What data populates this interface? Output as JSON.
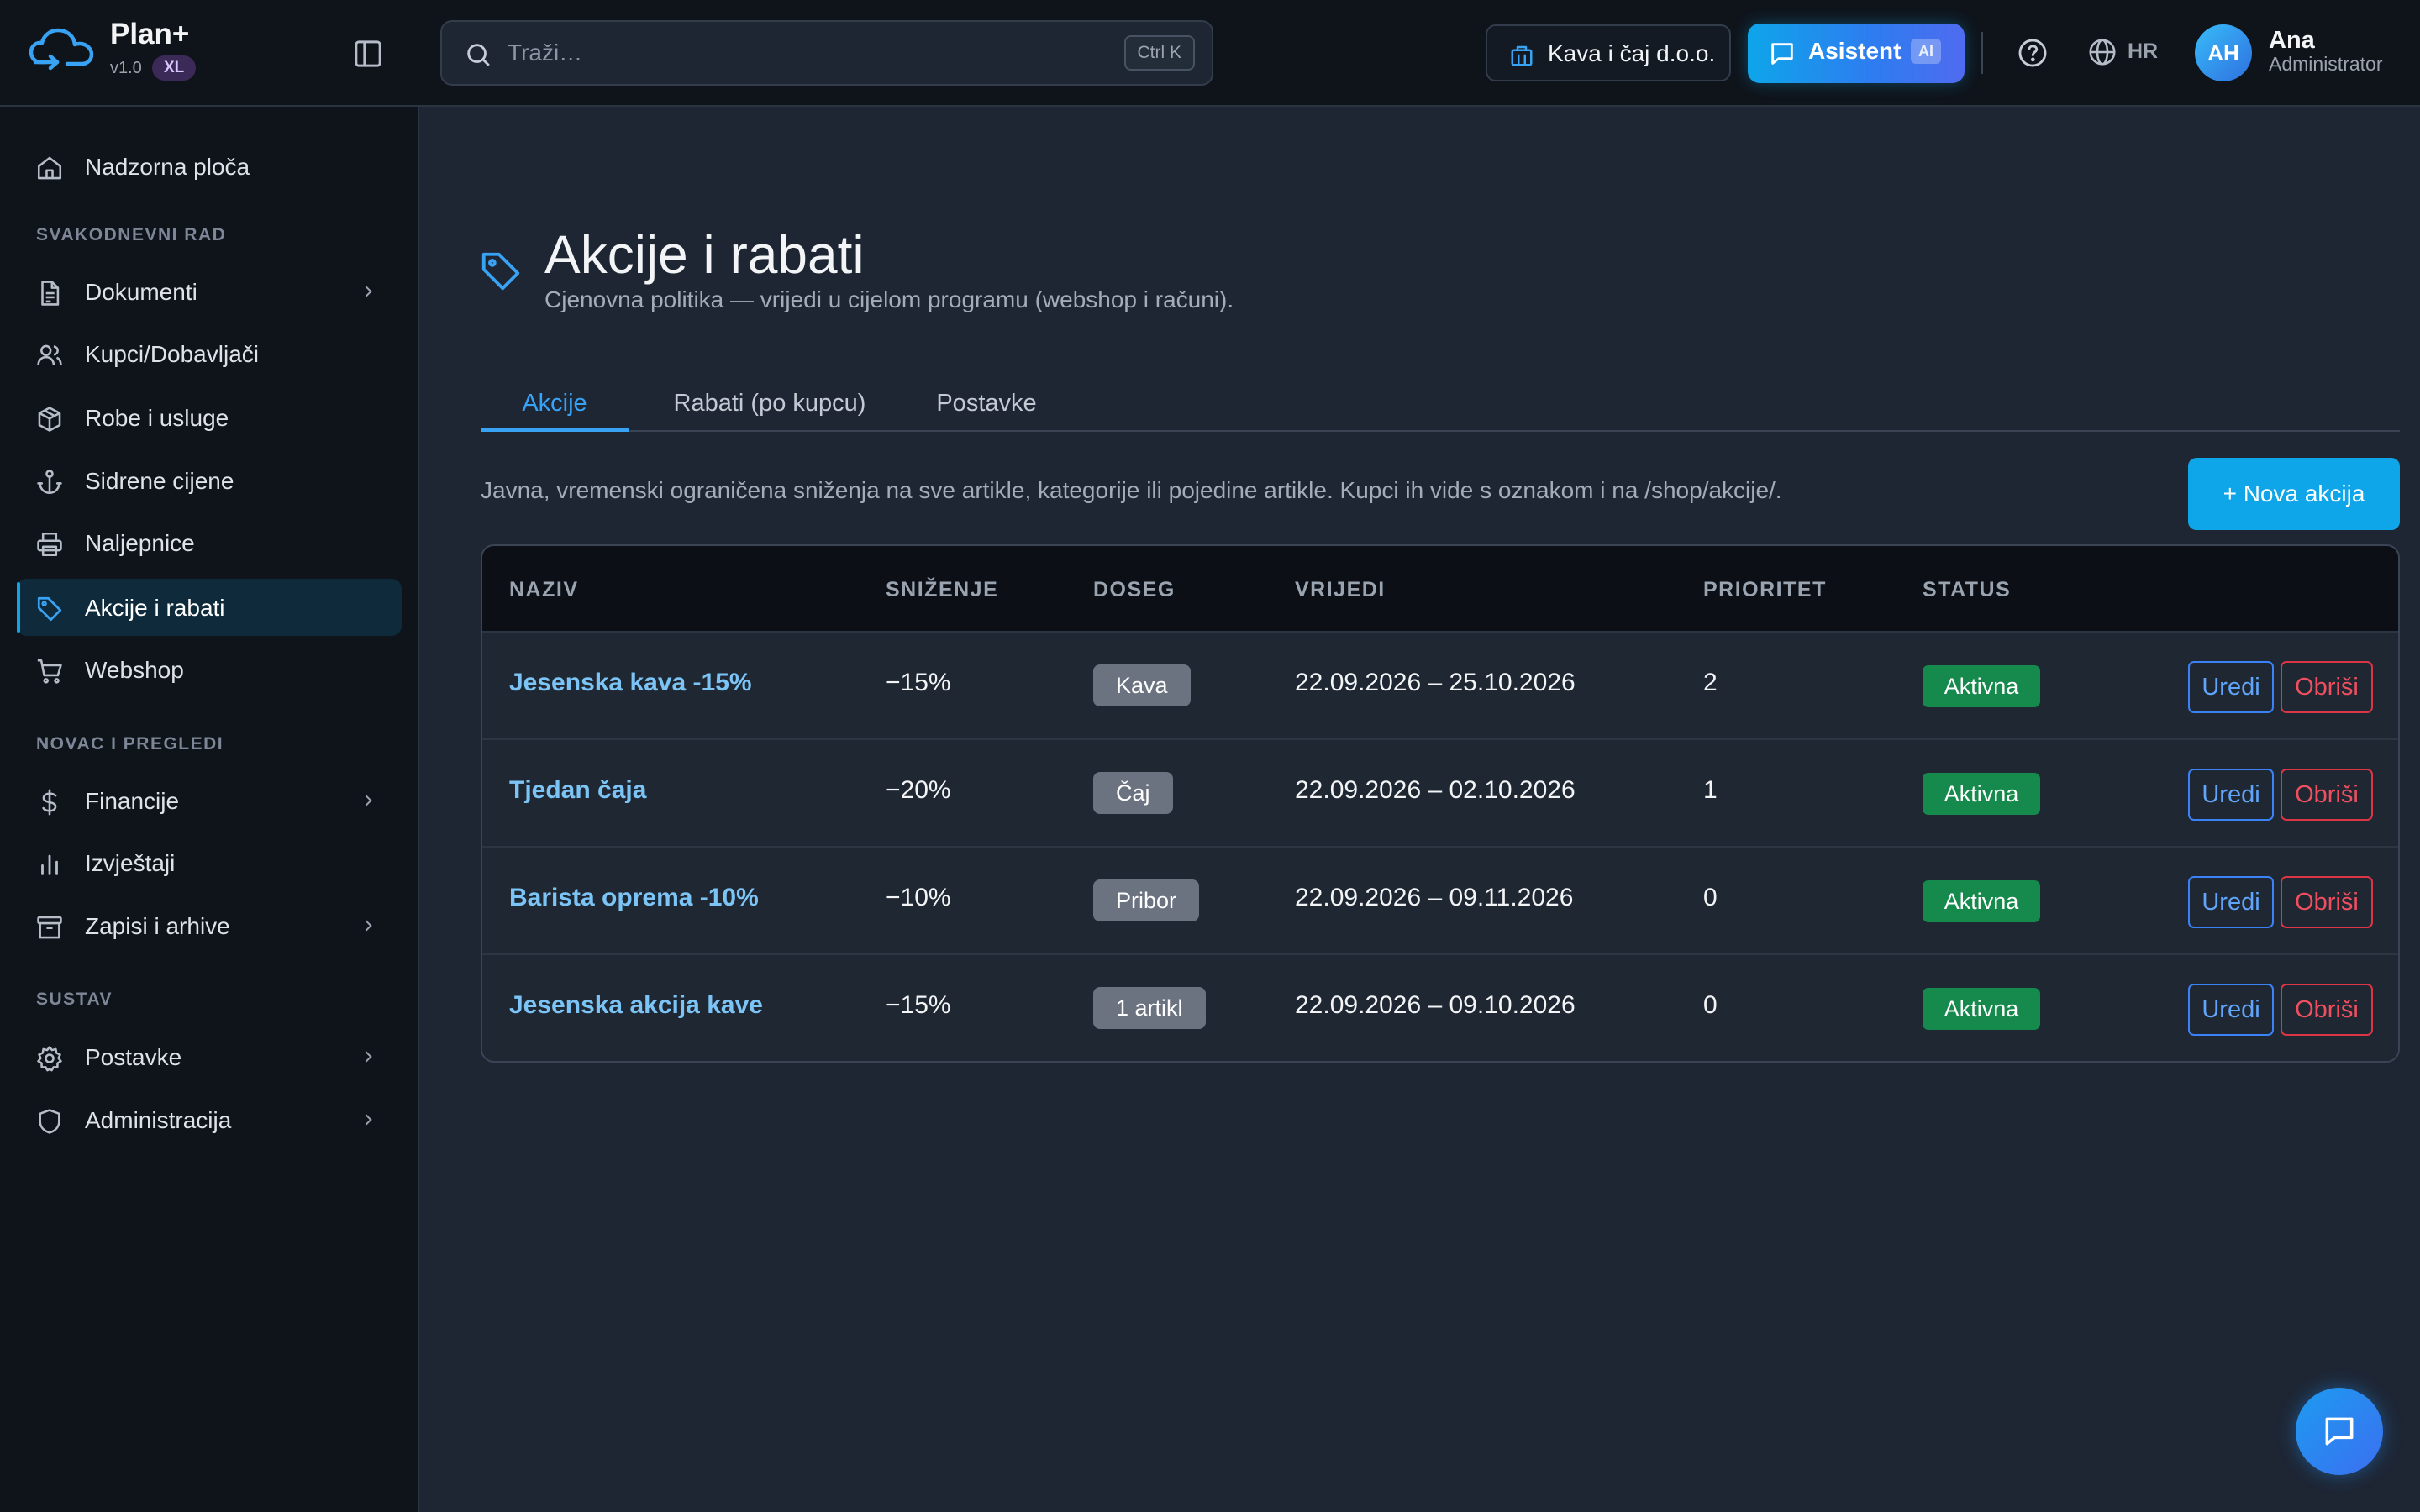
{
  "app": {
    "name": "Plan+",
    "version": "v1.0",
    "edition_badge": "XL"
  },
  "search": {
    "placeholder": "Traži…",
    "shortcut": "Ctrl K"
  },
  "header": {
    "company": "Kava i čaj d.o.o.",
    "assistant_label": "Asistent",
    "assistant_badge": "AI",
    "language": "HR",
    "user": {
      "initials": "AH",
      "name": "Ana",
      "role": "Administrator"
    },
    "icons": [
      "sidebar-toggle-icon",
      "search-icon",
      "building-icon",
      "chat-icon",
      "help-icon",
      "globe-icon"
    ]
  },
  "sidebar": {
    "dashboard": "Nadzorna ploča",
    "sections": {
      "daily": "SVAKODNEVNI RAD",
      "money": "NOVAC I PREGLEDI",
      "system": "SUSTAV"
    },
    "items": [
      {
        "label": "Dokumenti",
        "icon": "document-icon",
        "has_submenu": true
      },
      {
        "label": "Kupci/Dobavljači",
        "icon": "users-icon",
        "has_submenu": false
      },
      {
        "label": "Robe i usluge",
        "icon": "box-icon",
        "has_submenu": false
      },
      {
        "label": "Sidrene cijene",
        "icon": "anchor-icon",
        "has_submenu": false
      },
      {
        "label": "Naljepnice",
        "icon": "printer-icon",
        "has_submenu": false
      },
      {
        "label": "Akcije i rabati",
        "icon": "tag-icon",
        "has_submenu": false,
        "active": true
      },
      {
        "label": "Webshop",
        "icon": "cart-icon",
        "has_submenu": false
      },
      {
        "label": "Financije",
        "icon": "dollar-icon",
        "has_submenu": true
      },
      {
        "label": "Izvještaji",
        "icon": "bar-chart-icon",
        "has_submenu": false
      },
      {
        "label": "Zapisi i arhive",
        "icon": "archive-icon",
        "has_submenu": true
      },
      {
        "label": "Postavke",
        "icon": "gear-icon",
        "has_submenu": true
      },
      {
        "label": "Administracija",
        "icon": "shield-icon",
        "has_submenu": true
      }
    ]
  },
  "page": {
    "title": "Akcije i rabati",
    "subtitle": "Cjenovna politika — vrijedi u cijelom programu (webshop i računi).",
    "tabs": [
      {
        "label": "Akcije",
        "active": true
      },
      {
        "label": "Rabati (po kupcu)",
        "active": false
      },
      {
        "label": "Postavke",
        "active": false
      }
    ],
    "intro": "Javna, vremenski ograničena sniženja na sve artikle, kategorije ili pojedine artikle. Kupci ih vide s oznakom i na /shop/akcije/.",
    "new_button": "+ Nova akcija"
  },
  "table": {
    "columns": [
      "NAZIV",
      "SNIŽENJE",
      "DOSEG",
      "VRIJEDI",
      "PRIORITET",
      "STATUS"
    ],
    "rows": [
      {
        "name": "Jesenska kava -15%",
        "discount": "−15%",
        "scope": "Kava",
        "valid": "22.09.2026 – 25.10.2026",
        "priority": "2",
        "status": "Aktivna"
      },
      {
        "name": "Tjedan čaja",
        "discount": "−20%",
        "scope": "Čaj",
        "valid": "22.09.2026 – 02.10.2026",
        "priority": "1",
        "status": "Aktivna"
      },
      {
        "name": "Barista oprema -10%",
        "discount": "−10%",
        "scope": "Pribor",
        "valid": "22.09.2026 – 09.11.2026",
        "priority": "0",
        "status": "Aktivna"
      },
      {
        "name": "Jesenska akcija kave",
        "discount": "−15%",
        "scope": "1 artikl",
        "valid": "22.09.2026 – 09.10.2026",
        "priority": "0",
        "status": "Aktivna"
      }
    ],
    "actions": {
      "edit": "Uredi",
      "delete": "Obriši"
    }
  },
  "colors": {
    "accent": "#0ea5e9",
    "link": "#7cc4f5",
    "status_active": "#168a4c",
    "danger": "#dc3545",
    "background": "#1e2634",
    "sidebar": "#0f141b"
  }
}
